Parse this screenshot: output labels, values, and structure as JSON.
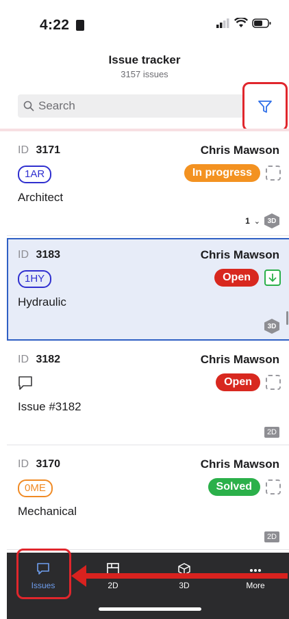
{
  "status_bar": {
    "time": "4:22"
  },
  "header": {
    "title": "Issue tracker",
    "subtitle": "3157 issues"
  },
  "search": {
    "placeholder": "Search"
  },
  "issues": [
    {
      "id_label": "ID",
      "id": "3171",
      "assignee": "Chris Mawson",
      "code": "1AR",
      "category": "Architect",
      "status": "In progress",
      "status_color": "#f39221",
      "count": "1",
      "badge": "3D"
    },
    {
      "id_label": "ID",
      "id": "3183",
      "assignee": "Chris Mawson",
      "code": "1HY",
      "category": "Hydraulic",
      "status": "Open",
      "status_color": "#d8281f",
      "badge": "3D"
    },
    {
      "id_label": "ID",
      "id": "3182",
      "assignee": "Chris Mawson",
      "category": "Issue #3182",
      "status": "Open",
      "status_color": "#d8281f",
      "badge": "2D"
    },
    {
      "id_label": "ID",
      "id": "3170",
      "assignee": "Chris Mawson",
      "code": "0ME",
      "category": "Mechanical",
      "status": "Solved",
      "status_color": "#2bb04a",
      "badge": "2D"
    }
  ],
  "tabs": [
    {
      "label": "Issues",
      "icon": "chat-bubble-icon"
    },
    {
      "label": "2D",
      "icon": "floorplan-icon"
    },
    {
      "label": "3D",
      "icon": "cube-icon"
    },
    {
      "label": "More",
      "icon": "more-dots-icon"
    }
  ],
  "colors": {
    "accent": "#2f6fe8",
    "highlight": "#e0262c",
    "tabbar": "#2b2b2d"
  }
}
